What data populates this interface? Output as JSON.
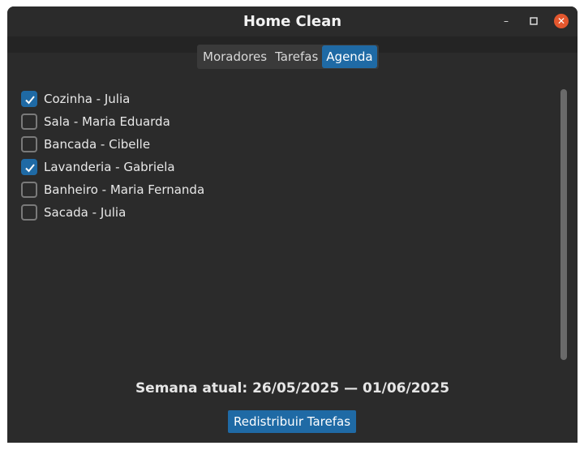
{
  "window": {
    "title": "Home Clean",
    "controls": {
      "minimize": "–",
      "maximize": "□",
      "close": "✕"
    }
  },
  "tabs": [
    {
      "label": "Moradores",
      "active": false
    },
    {
      "label": "Tarefas",
      "active": false
    },
    {
      "label": "Agenda",
      "active": true
    }
  ],
  "schedule": {
    "items": [
      {
        "label": "Cozinha - Julia",
        "checked": true
      },
      {
        "label": "Sala - Maria Eduarda",
        "checked": false
      },
      {
        "label": "Bancada - Cibelle",
        "checked": false
      },
      {
        "label": "Lavanderia - Gabriela",
        "checked": true
      },
      {
        "label": "Banheiro - Maria Fernanda",
        "checked": false
      },
      {
        "label": "Sacada - Julia",
        "checked": false
      }
    ]
  },
  "footer": {
    "week_text": "Semana atual: 26/05/2025 — 01/06/2025",
    "redistribute_label": "Redistribuir Tarefas"
  },
  "colors": {
    "accent": "#1f6aa5",
    "background": "#2b2b2b",
    "close_button": "#e4572e"
  }
}
